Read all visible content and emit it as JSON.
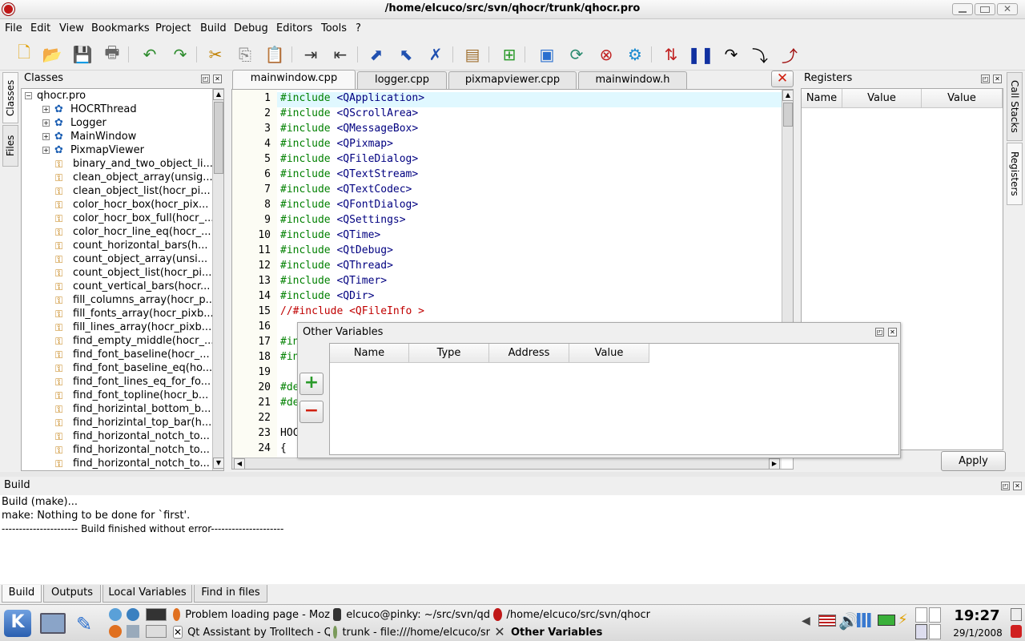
{
  "window": {
    "title": "/home/elcuco/src/svn/qhocr/trunk/qhocr.pro"
  },
  "menu": [
    "File",
    "Edit",
    "View",
    "Bookmarks",
    "Project",
    "Build",
    "Debug",
    "Editors",
    "Tools",
    "?"
  ],
  "toolbar_icons": [
    "new-file-icon",
    "open-file-icon",
    "save-icon",
    "print-icon",
    "undo-icon",
    "redo-icon",
    "cut-icon",
    "copy-icon",
    "paste-icon",
    "indent-icon",
    "unindent-icon",
    "debug-step-icon",
    "debug-step-out-icon",
    "debug-stop-icon",
    "build-icon",
    "new-project-icon",
    "build-project-icon",
    "rebuild-icon",
    "stop-build-icon",
    "configure-icon",
    "sort-icon",
    "pause-icon",
    "step-over-icon",
    "step-into-icon",
    "step-out-icon"
  ],
  "left_tabs": [
    "Classes",
    "Files"
  ],
  "right_tabs": [
    "Call Stacks",
    "Registers"
  ],
  "classes": {
    "title": "Classes",
    "root": "qhocr.pro",
    "class_items": [
      "HOCRThread",
      "Logger",
      "MainWindow",
      "PixmapViewer"
    ],
    "functions": [
      "binary_and_two_object_li...",
      "clean_object_array(unsig...",
      "clean_object_list(hocr_pi...",
      "color_hocr_box(hocr_pix...",
      "color_hocr_box_full(hocr_...",
      "color_hocr_line_eq(hocr_...",
      "count_horizontal_bars(h...",
      "count_object_array(unsi...",
      "count_object_list(hocr_pi...",
      "count_vertical_bars(hocr...",
      "fill_columns_array(hocr_p...",
      "fill_fonts_array(hocr_pixb...",
      "fill_lines_array(hocr_pixb...",
      "find_empty_middle(hocr_...",
      "find_font_baseline(hocr_...",
      "find_font_baseline_eq(ho...",
      "find_font_lines_eq_for_fo...",
      "find_font_topline(hocr_b...",
      "find_horizintal_bottom_b...",
      "find_horizintal_top_bar(h...",
      "find_horizontal_notch_to...",
      "find_horizontal_notch_to...",
      "find_horizontal_notch_to..."
    ]
  },
  "editor": {
    "tabs": [
      "mainwindow.cpp",
      "logger.cpp",
      "pixmapviewer.cpp",
      "mainwindow.h"
    ],
    "lines": [
      {
        "n": "1",
        "kw": "#include",
        "arg": " <QApplication>"
      },
      {
        "n": "2",
        "kw": "#include",
        "arg": " <QScrollArea>"
      },
      {
        "n": "3",
        "kw": "#include",
        "arg": " <QMessageBox>"
      },
      {
        "n": "4",
        "kw": "#include",
        "arg": " <QPixmap>"
      },
      {
        "n": "5",
        "kw": "#include",
        "arg": " <QFileDialog>"
      },
      {
        "n": "6",
        "kw": "#include",
        "arg": " <QTextStream>"
      },
      {
        "n": "7",
        "kw": "#include",
        "arg": " <QTextCodec>"
      },
      {
        "n": "8",
        "kw": "#include",
        "arg": " <QFontDialog>"
      },
      {
        "n": "9",
        "kw": "#include",
        "arg": " <QSettings>"
      },
      {
        "n": "10",
        "kw": "#include",
        "arg": " <QTime>"
      },
      {
        "n": "11",
        "kw": "#include",
        "arg": " <QtDebug>"
      },
      {
        "n": "12",
        "kw": "#include",
        "arg": " <QThread>"
      },
      {
        "n": "13",
        "kw": "#include",
        "arg": " <QTimer>"
      },
      {
        "n": "14",
        "kw": "#include",
        "arg": " <QDir>"
      },
      {
        "n": "15",
        "cm": "//#include <QFileInfo >"
      },
      {
        "n": "16"
      },
      {
        "n": "17",
        "kw": "#in"
      },
      {
        "n": "18",
        "kw": "#in"
      },
      {
        "n": "19"
      },
      {
        "n": "20",
        "kw": "#de"
      },
      {
        "n": "21",
        "kw": "#de"
      },
      {
        "n": "22"
      },
      {
        "n": "23",
        "plain": "HOC"
      },
      {
        "n": "24",
        "plain": "{"
      }
    ]
  },
  "registers": {
    "title": "Registers",
    "columns": [
      "Name",
      "Value",
      "Value"
    ],
    "apply_label": "Apply"
  },
  "other_variables": {
    "title": "Other Variables",
    "columns": [
      "Name",
      "Type",
      "Address",
      "Value"
    ],
    "add_label": "+",
    "remove_label": "−"
  },
  "build": {
    "title": "Build",
    "lines": [
      "Build (make)...",
      "make: Nothing to be done for `first'.",
      "---------------------- Build finished without error---------------------"
    ],
    "tabs": [
      "Build",
      "Outputs",
      "Local Variables",
      "Find in files"
    ]
  },
  "taskbar": {
    "tasks": [
      "Problem loading page - Moz",
      "Qt Assistant by Trolltech - Q",
      "elcuco@pinky: ~/src/svn/qd",
      "trunk - file:///home/elcuco/sr",
      "/home/elcuco/src/svn/qhocr",
      "Other Variables"
    ],
    "time": "19:27",
    "date": "29/1/2008"
  }
}
